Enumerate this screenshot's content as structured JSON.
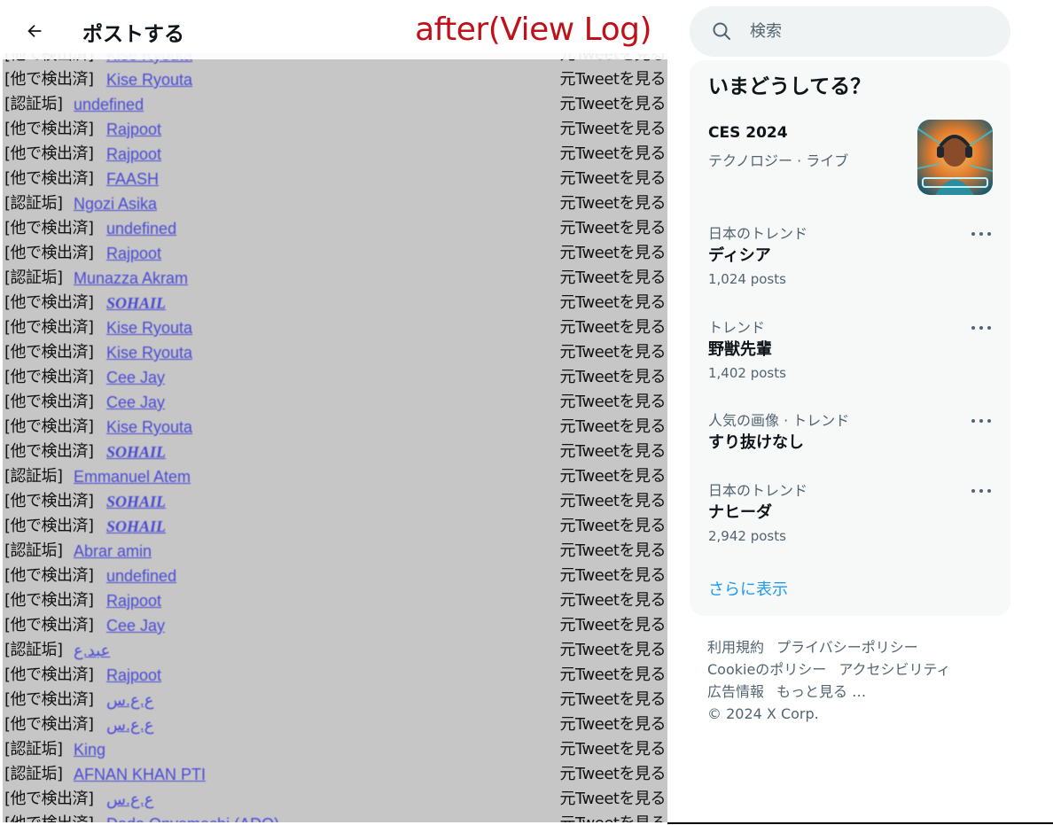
{
  "header": {
    "title": "ポストする",
    "overlay_label": "after(View Log)"
  },
  "log": {
    "action_label": "元Tweetを見る",
    "rows": [
      {
        "tag": "[他で検出済]",
        "name": "Kise Ryouta",
        "bold": false
      },
      {
        "tag": "[他で検出済]",
        "name": "Kise Ryouta",
        "bold": false
      },
      {
        "tag": "[認証垢]",
        "name": "undefined",
        "bold": false
      },
      {
        "tag": "[他で検出済]",
        "name": "Rajpoot",
        "bold": false
      },
      {
        "tag": "[他で検出済]",
        "name": "Rajpoot",
        "bold": false
      },
      {
        "tag": "[他で検出済]",
        "name": "FAASH",
        "bold": false
      },
      {
        "tag": "[認証垢]",
        "name": "Ngozi Asika",
        "bold": false
      },
      {
        "tag": "[他で検出済]",
        "name": "undefined",
        "bold": false
      },
      {
        "tag": "[他で検出済]",
        "name": "Rajpoot",
        "bold": false
      },
      {
        "tag": "[認証垢]",
        "name": "Munazza Akram",
        "bold": false
      },
      {
        "tag": "[他で検出済]",
        "name": "SOHAIL",
        "bold": true
      },
      {
        "tag": "[他で検出済]",
        "name": "Kise Ryouta",
        "bold": false
      },
      {
        "tag": "[他で検出済]",
        "name": "Kise Ryouta",
        "bold": false
      },
      {
        "tag": "[他で検出済]",
        "name": "Cee Jay",
        "bold": false
      },
      {
        "tag": "[他で検出済]",
        "name": "Cee Jay",
        "bold": false
      },
      {
        "tag": "[他で検出済]",
        "name": "Kise Ryouta",
        "bold": false
      },
      {
        "tag": "[他で検出済]",
        "name": "SOHAIL",
        "bold": true
      },
      {
        "tag": "[認証垢]",
        "name": "Emmanuel Atem",
        "bold": false
      },
      {
        "tag": "[他で検出済]",
        "name": "SOHAIL",
        "bold": true
      },
      {
        "tag": "[他で検出済]",
        "name": "SOHAIL",
        "bold": true
      },
      {
        "tag": "[認証垢]",
        "name": "Abrar amin",
        "bold": false
      },
      {
        "tag": "[他で検出済]",
        "name": "undefined",
        "bold": false
      },
      {
        "tag": "[他で検出済]",
        "name": "Rajpoot",
        "bold": false
      },
      {
        "tag": "[他で検出済]",
        "name": "Cee Jay",
        "bold": false
      },
      {
        "tag": "[認証垢]",
        "name": "عبد.ع",
        "bold": false
      },
      {
        "tag": "[他で検出済]",
        "name": "Rajpoot",
        "bold": false
      },
      {
        "tag": "[他で検出済]",
        "name": "ع.ع.س",
        "bold": false
      },
      {
        "tag": "[他で検出済]",
        "name": "ع.ع.س",
        "bold": false
      },
      {
        "tag": "[認証垢]",
        "name": "King",
        "bold": false
      },
      {
        "tag": "[認証垢]",
        "name": "AFNAN KHAN PTI",
        "bold": false
      },
      {
        "tag": "[他で検出済]",
        "name": "ع.ع.س",
        "bold": false
      },
      {
        "tag": "[他で検出済]",
        "name": "Dada Onyemechi (ADO)",
        "bold": false
      }
    ]
  },
  "search": {
    "placeholder": "検索",
    "icon": "search-icon"
  },
  "trends": {
    "title": "いまどうしてる？",
    "event": {
      "title": "CES 2024",
      "subtitle": "テクノロジー · ライブ"
    },
    "items": [
      {
        "category": "日本のトレンド",
        "name": "ディシア",
        "count": "1,024 posts"
      },
      {
        "category": "トレンド",
        "name": "野獣先輩",
        "count": "1,402 posts"
      },
      {
        "category": "人気の画像 · トレンド",
        "name": "すり抜けなし",
        "count": ""
      },
      {
        "category": "日本のトレンド",
        "name": "ナヒーダ",
        "count": "2,942 posts"
      }
    ],
    "show_more": "さらに表示"
  },
  "footer": {
    "links": [
      "利用規約",
      "プライバシーポリシー",
      "Cookieのポリシー",
      "アクセシビリティ",
      "広告情報",
      "もっと見る …"
    ],
    "copyright": "© 2024 X Corp."
  }
}
